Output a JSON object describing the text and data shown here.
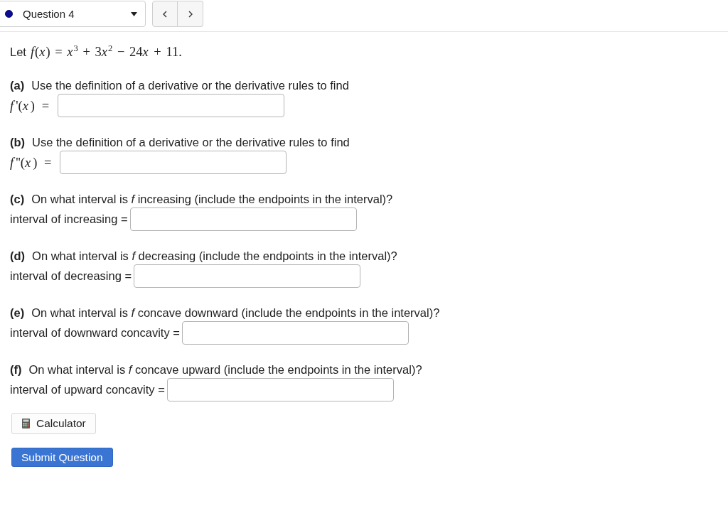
{
  "question_select": {
    "label": "Question 4"
  },
  "statement": {
    "intro": "Let",
    "formula": "f(x) = x$^{3}$ + 3x$^{2}$ − 24x + 11."
  },
  "parts": [
    {
      "label": "(a)",
      "prompt": "Use the definition of a derivative or the derivative rules to find",
      "kind": "math",
      "answer_label": "f'(x) ="
    },
    {
      "label": "(b)",
      "prompt": "Use the definition of a derivative or the derivative rules to find",
      "kind": "math",
      "answer_label": "f''(x) ="
    },
    {
      "label": "(c)",
      "prompt": "On what interval is *f* increasing (include the endpoints in the interval)?",
      "kind": "text",
      "answer_label": "interval of increasing ="
    },
    {
      "label": "(d)",
      "prompt": "On what interval is *f* decreasing (include the endpoints in the interval)?",
      "kind": "text",
      "answer_label": "interval of decreasing ="
    },
    {
      "label": "(e)",
      "prompt": "On what interval is *f* concave downward (include the endpoints in the interval)?",
      "kind": "text",
      "answer_label": "interval of downward concavity ="
    },
    {
      "label": "(f)",
      "prompt": "On what interval is *f* concave upward (include the endpoints in the interval)?",
      "kind": "text",
      "answer_label": "interval of upward concavity ="
    }
  ],
  "buttons": {
    "calculator": "Calculator",
    "submit": "Submit Question"
  }
}
